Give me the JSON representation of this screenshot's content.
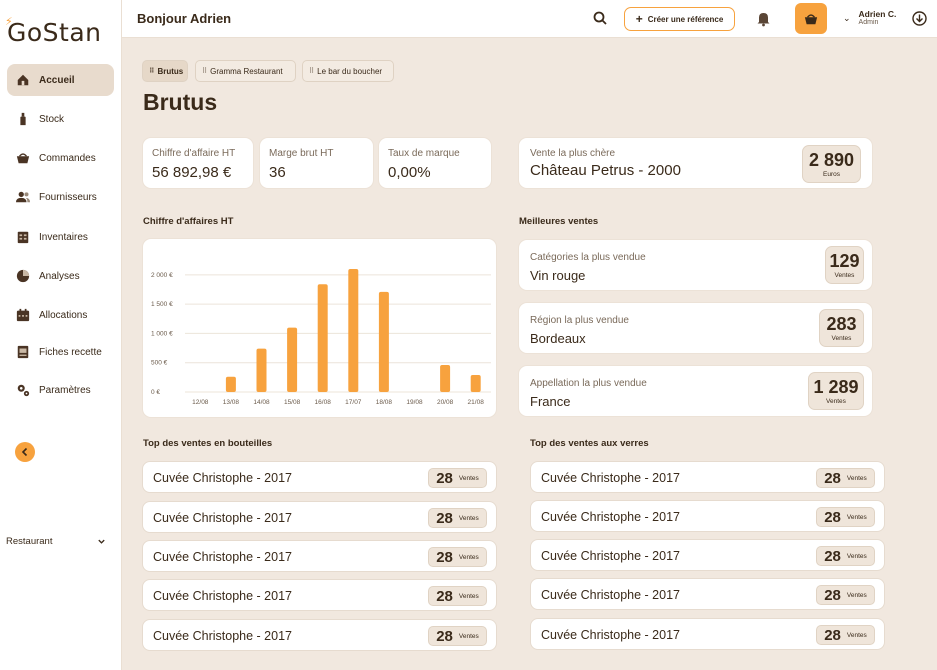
{
  "app": {
    "logo": "GoStan"
  },
  "sidebar": {
    "items": [
      {
        "label": "Accueil",
        "icon": "home-icon",
        "active": true
      },
      {
        "label": "Stock",
        "icon": "bottle-icon"
      },
      {
        "label": "Commandes",
        "icon": "basket-icon"
      },
      {
        "label": "Fournisseurs",
        "icon": "users-icon"
      },
      {
        "label": "Inventaires",
        "icon": "clipboard-icon"
      },
      {
        "label": "Analyses",
        "icon": "pie-icon"
      },
      {
        "label": "Allocations",
        "icon": "calendar-icon"
      },
      {
        "label": "Fiches recette",
        "icon": "recipe-icon"
      },
      {
        "label": "Paramètres",
        "icon": "settings-icon"
      }
    ],
    "restaurant_label": "Restaurant"
  },
  "topbar": {
    "greeting": "Bonjour Adrien",
    "create_label": "Créer une référence",
    "user_name": "Adrien C.",
    "user_role": "Admin"
  },
  "tabs": [
    "Brutus",
    "Gramma Restaurant",
    "Le bar du boucher"
  ],
  "page_title": "Brutus",
  "kpis": [
    {
      "label": "Chiffre d'affaire HT",
      "value": "56 892,98 €"
    },
    {
      "label": "Marge brut HT",
      "value": "36"
    },
    {
      "label": "Taux de marque",
      "value": "0,00%"
    }
  ],
  "most_expensive": {
    "label": "Vente la plus chère",
    "value": "Château Petrus - 2000",
    "amount": "2 890",
    "unit": "Euros"
  },
  "chart_section_title": "Chiffre d'affaires HT",
  "best_sales_title": "Meilleures ventes",
  "best_sales": [
    {
      "label": "Catégories la plus vendue",
      "value": "Vin rouge",
      "count": "129",
      "unit": "Ventes"
    },
    {
      "label": "Région la plus vendue",
      "value": "Bordeaux",
      "count": "283",
      "unit": "Ventes"
    },
    {
      "label": "Appellation la plus vendue",
      "value": "France",
      "count": "1 289",
      "unit": "Ventes"
    }
  ],
  "top_bottles_title": "Top des ventes en bouteilles",
  "top_glasses_title": "Top des ventes aux verres",
  "top_bottles": [
    {
      "name": "Cuvée Christophe - 2017",
      "count": "28",
      "unit": "Ventes"
    },
    {
      "name": "Cuvée Christophe - 2017",
      "count": "28",
      "unit": "Ventes"
    },
    {
      "name": "Cuvée Christophe - 2017",
      "count": "28",
      "unit": "Ventes"
    },
    {
      "name": "Cuvée Christophe - 2017",
      "count": "28",
      "unit": "Ventes"
    },
    {
      "name": "Cuvée Christophe - 2017",
      "count": "28",
      "unit": "Ventes"
    }
  ],
  "top_glasses": [
    {
      "name": "Cuvée Christophe - 2017",
      "count": "28",
      "unit": "Ventes"
    },
    {
      "name": "Cuvée Christophe - 2017",
      "count": "28",
      "unit": "Ventes"
    },
    {
      "name": "Cuvée Christophe - 2017",
      "count": "28",
      "unit": "Ventes"
    },
    {
      "name": "Cuvée Christophe - 2017",
      "count": "28",
      "unit": "Ventes"
    },
    {
      "name": "Cuvée Christophe - 2017",
      "count": "28",
      "unit": "Ventes"
    }
  ],
  "colors": {
    "accent": "#f7a23e",
    "background": "#f1e8df",
    "text": "#3a2a1a"
  },
  "chart_data": {
    "type": "bar",
    "categories": [
      "12/08",
      "13/08",
      "14/08",
      "15/08",
      "16/08",
      "17/07",
      "18/08",
      "19/08",
      "20/08",
      "21/08"
    ],
    "values": [
      0,
      260,
      740,
      1100,
      1840,
      2100,
      1710,
      0,
      460,
      290
    ],
    "yticks": [
      0,
      500,
      1000,
      1500,
      2000
    ],
    "ytick_labels": [
      "0 €",
      "500 €",
      "1 000 €",
      "1 500 €",
      "2 000 €"
    ],
    "ylim": [
      0,
      2100
    ],
    "grid": true,
    "color": "#f7a23e"
  }
}
